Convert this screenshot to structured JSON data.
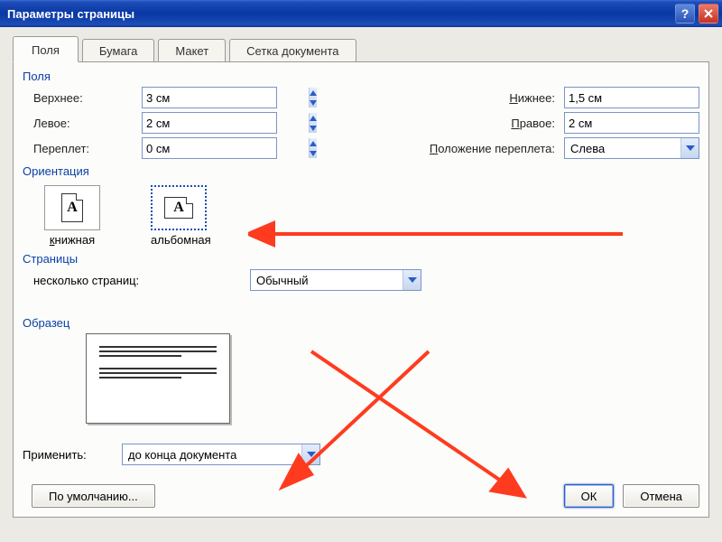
{
  "title": "Параметры страницы",
  "tabs": [
    "Поля",
    "Бумага",
    "Макет",
    "Сетка документа"
  ],
  "active_tab": 0,
  "groups": {
    "margins": {
      "label": "Поля",
      "top_lbl": "Верхнее:",
      "top_val": "3 см",
      "bottom_lbl": "Нижнее:",
      "bottom_val": "1,5 см",
      "left_lbl": "Левое:",
      "left_val": "2 см",
      "right_lbl": "Правое:",
      "right_val": "2 см",
      "gutter_lbl": "Переплет:",
      "gutter_val": "0 см",
      "gutterpos_lbl": "Положение переплета:",
      "gutterpos_val": "Слева"
    },
    "orientation": {
      "label": "Ориентация",
      "portrait": "книжная",
      "landscape": "альбомная",
      "selected": "landscape"
    },
    "pages": {
      "label": "Страницы",
      "multi_lbl": "несколько страниц:",
      "multi_val": "Обычный"
    },
    "preview": {
      "label": "Образец",
      "apply_lbl": "Применить:",
      "apply_val": "до конца документа"
    }
  },
  "buttons": {
    "default": "По умолчанию...",
    "ok": "ОК",
    "cancel": "Отмена"
  }
}
